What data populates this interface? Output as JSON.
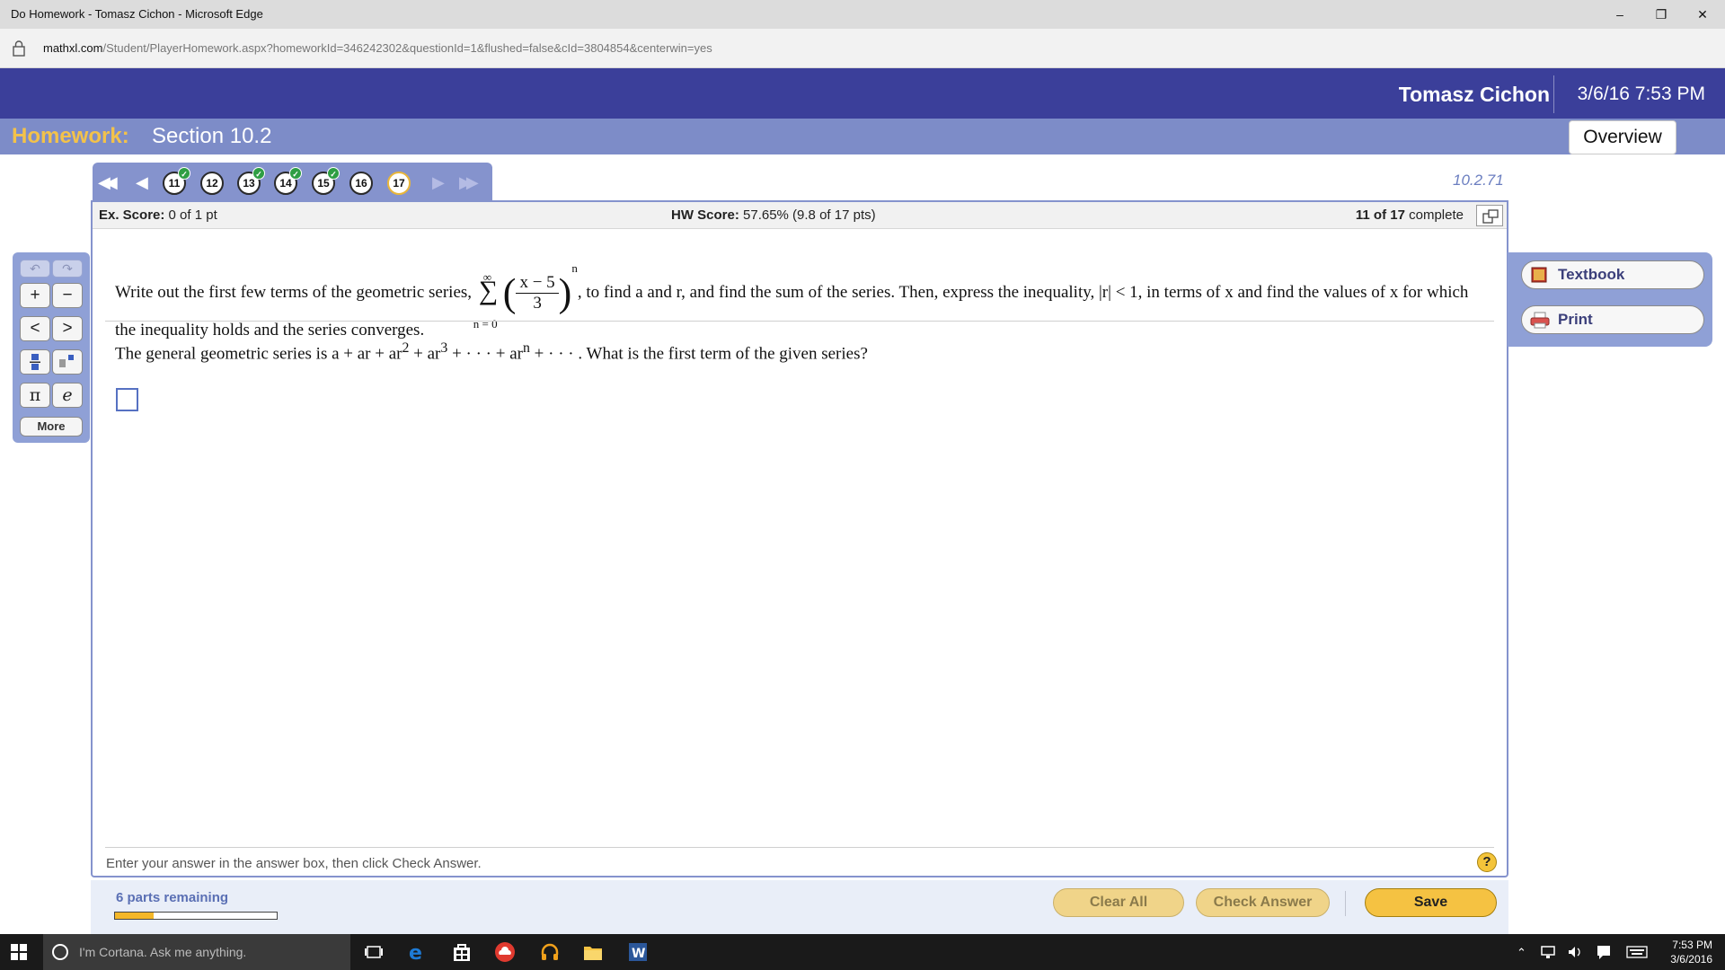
{
  "window": {
    "title": "Do Homework - Tomasz Cichon - Microsoft Edge",
    "minimize": "–",
    "restore": "❐",
    "close": "✕"
  },
  "address": {
    "host": "mathxl.com",
    "path": "/Student/PlayerHomework.aspx?homeworkId=346242302&questionId=1&flushed=false&cId=3804854&centerwin=yes"
  },
  "header": {
    "user": "Tomasz Cichon",
    "datetime": "3/6/16 7:53 PM"
  },
  "homework": {
    "label": "Homework:",
    "section": "Section 10.2",
    "overview": "Overview"
  },
  "nav": {
    "first": "◀◀",
    "prev": "◀",
    "next": "▶",
    "last": "▶▶",
    "questions": [
      "11",
      "12",
      "13",
      "14",
      "15",
      "16",
      "17"
    ],
    "check": "✓",
    "question_number": "10.2.71"
  },
  "score": {
    "ex_label": "Ex. Score:",
    "ex_value": "0 of 1 pt",
    "hw_label": "HW Score:",
    "hw_value": "57.65% (9.8 of 17 pts)",
    "complete_count": "11 of 17",
    "complete_label": "complete"
  },
  "question": {
    "part1": "Write out the first few terms of the geometric series,",
    "sum_top": "∞",
    "sum_sigma": "∑",
    "sum_bottom": "n = 0",
    "frac_num": "x − 5",
    "frac_den": "3",
    "exponent": "n",
    "part2": ", to find a and r, and find the sum of the series. Then, express the inequality, |r| < 1, in terms of x and find the values of x for which the inequality holds and the series converges.",
    "prompt_a": "The general geometric series is a + ar + ar",
    "sup2": "2",
    "prompt_b": " + ar",
    "sup3": "3",
    "prompt_c": " + · · · + ar",
    "supn": "n",
    "prompt_d": " + · · · . What is the first term of the given series?"
  },
  "instructions": "Enter your answer in the answer box, then click Check Answer.",
  "help": "?",
  "palette": {
    "undo": "↶",
    "redo": "↷",
    "plus": "+",
    "minus": "−",
    "lt": "<",
    "gt": ">",
    "pi": "π",
    "e": "e",
    "more": "More"
  },
  "tools": {
    "textbook": "Textbook",
    "print": "Print"
  },
  "bottom": {
    "parts_remaining": "6 parts remaining",
    "progress": 0.24,
    "clear_all": "Clear All",
    "check_answer": "Check Answer",
    "save": "Save"
  },
  "taskbar": {
    "cortana": "I'm Cortana. Ask me anything.",
    "time": "7:53 PM",
    "date": "3/6/2016"
  },
  "colors": {
    "header": "#3b3f9a",
    "hwbar": "#7d8cc8",
    "accent_gold": "#f3c24a",
    "button_primary": "#f5c242"
  }
}
